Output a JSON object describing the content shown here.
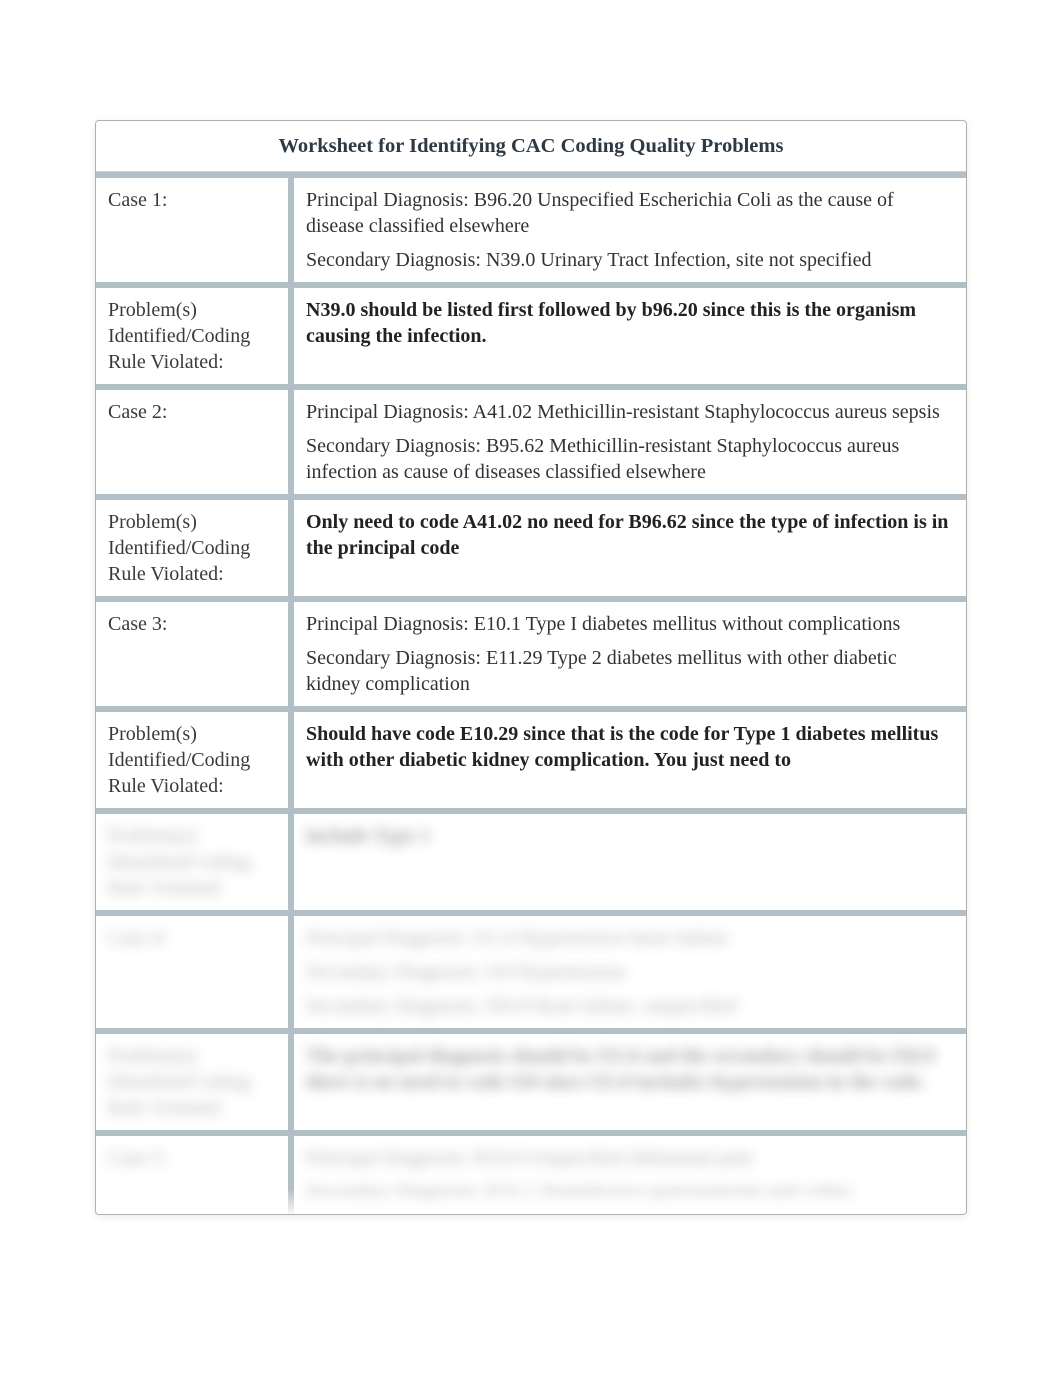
{
  "title": "Worksheet for Identifying CAC Coding Quality Problems",
  "rows": [
    {
      "label": "Case 1:",
      "content": [
        "Principal Diagnosis: B96.20 Unspecified Escherichia Coli as the cause of disease classified elsewhere",
        "Secondary Diagnosis: N39.0 Urinary Tract Infection, site not specified"
      ],
      "bold": false
    },
    {
      "label": "Problem(s) Identified/Coding Rule Violated:",
      "content": [
        "N39.0 should be listed first followed by b96.20 since this is the organism causing the infection."
      ],
      "bold": true
    },
    {
      "label": "Case 2:",
      "content": [
        "Principal Diagnosis: A41.02 Methicillin-resistant Staphylococcus aureus sepsis",
        "Secondary Diagnosis: B95.62 Methicillin-resistant Staphylococcus aureus infection as cause of diseases classified elsewhere"
      ],
      "bold": false
    },
    {
      "label": "Problem(s) Identified/Coding Rule Violated:",
      "content": [
        " Only need to code A41.02 no need for B96.62 since the type of infection is in the principal code"
      ],
      "bold": true
    },
    {
      "label": "Case 3:",
      "content": [
        "Principal Diagnosis: E10.1 Type I diabetes mellitus without complications",
        "Secondary Diagnosis: E11.29 Type 2 diabetes mellitus with other diabetic kidney complication"
      ],
      "bold": false
    },
    {
      "label": "Problem(s) Identified/Coding Rule Violated:",
      "content": [
        "Should have code E10.29 since that is the code for Type 1 diabetes mellitus with other diabetic kidney complication. You just need to"
      ],
      "bold": true
    }
  ],
  "blurred_rows": [
    {
      "label": "Problem(s) Identified/Coding Rule Violated:",
      "content": [
        "include Type 1"
      ],
      "bold": true
    },
    {
      "label": "Case 4:",
      "content": [
        "Principal Diagnosis: I11.0 Hypertensive heart failure",
        "Secondary Diagnosis: I10 Hypertension",
        "Secondary Diagnosis: I50.9 Heart failure, unspecified"
      ],
      "bold": false
    },
    {
      "label": "Problem(s) Identified/Coding Rule Violated:",
      "content": [
        "The principal diagnosis should be I11.0 and the secondary should be I50.9 there is no need to code I10 since I11.0 includes hypertension in the code."
      ],
      "bold": true
    },
    {
      "label": "Case 5:",
      "content": [
        "Principal Diagnosis: R10.9 Unspecified abdominal pain",
        "Secondary Diagnosis: K52.1 Noninfective gastroenteritis and colitis"
      ],
      "bold": false
    }
  ]
}
